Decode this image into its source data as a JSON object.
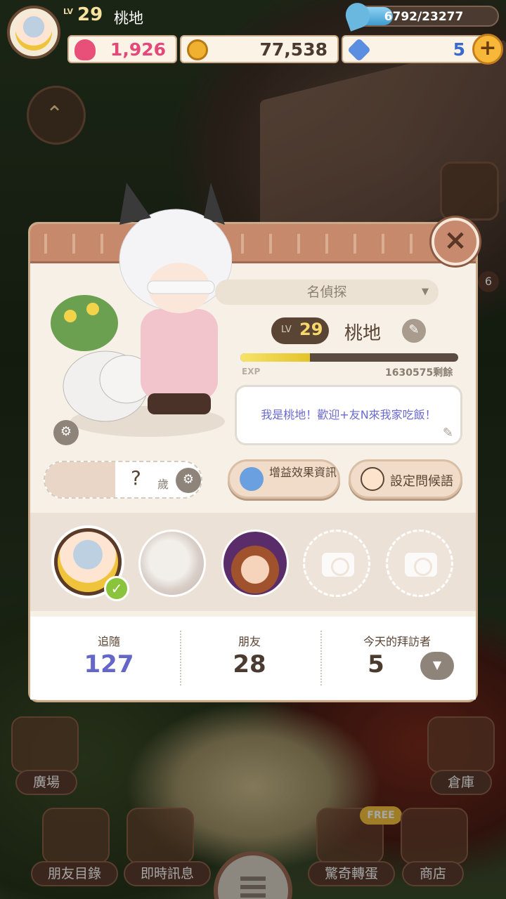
{
  "hud": {
    "level_prefix": "LV",
    "level": "29",
    "player_name": "桃地",
    "exp_text": "6792/23277",
    "exp_fraction": 0.29,
    "hearts": "1,926",
    "coins": "77,538",
    "gems": "5",
    "add_symbol": "+"
  },
  "profile": {
    "title": "名偵探",
    "level_prefix": "LV",
    "level": "29",
    "name": "桃地",
    "exp_label": "EXP",
    "exp_fraction": 0.32,
    "exp_remaining": "1630575剩餘",
    "greeting": "我是桃地！歡迎+友N來我家吃飯！",
    "age_value": "?",
    "age_unit": "歲",
    "buff_button_label": "增益效果資訊",
    "greet_button_label": "設定問候語",
    "close_symbol": "×"
  },
  "stats": [
    {
      "label": "追隨",
      "value": "127",
      "color": "#6466c8"
    },
    {
      "label": "朋友",
      "value": "28",
      "color": "#4a3a30"
    },
    {
      "label": "今天的拜訪者",
      "value": "5",
      "color": "#4a3a30"
    }
  ],
  "menu": {
    "plaza": "廣場",
    "warehouse": "倉庫",
    "friends_list": "朋友目錄",
    "messages": "即時訊息",
    "gacha": "驚奇轉蛋",
    "shop": "商店",
    "free_badge": "FREE"
  },
  "side_badge": "6",
  "icons": [
    "heart-icon",
    "coin-icon",
    "gem-icon",
    "leaf-icon",
    "close-icon",
    "edit-icon",
    "gear-icon",
    "camera-icon",
    "check-icon",
    "dropdown-icon",
    "menu-icon"
  ],
  "colors": {
    "accent": "#c6896c",
    "exp_fill": "#e4c32a",
    "follow": "#6466c8"
  }
}
